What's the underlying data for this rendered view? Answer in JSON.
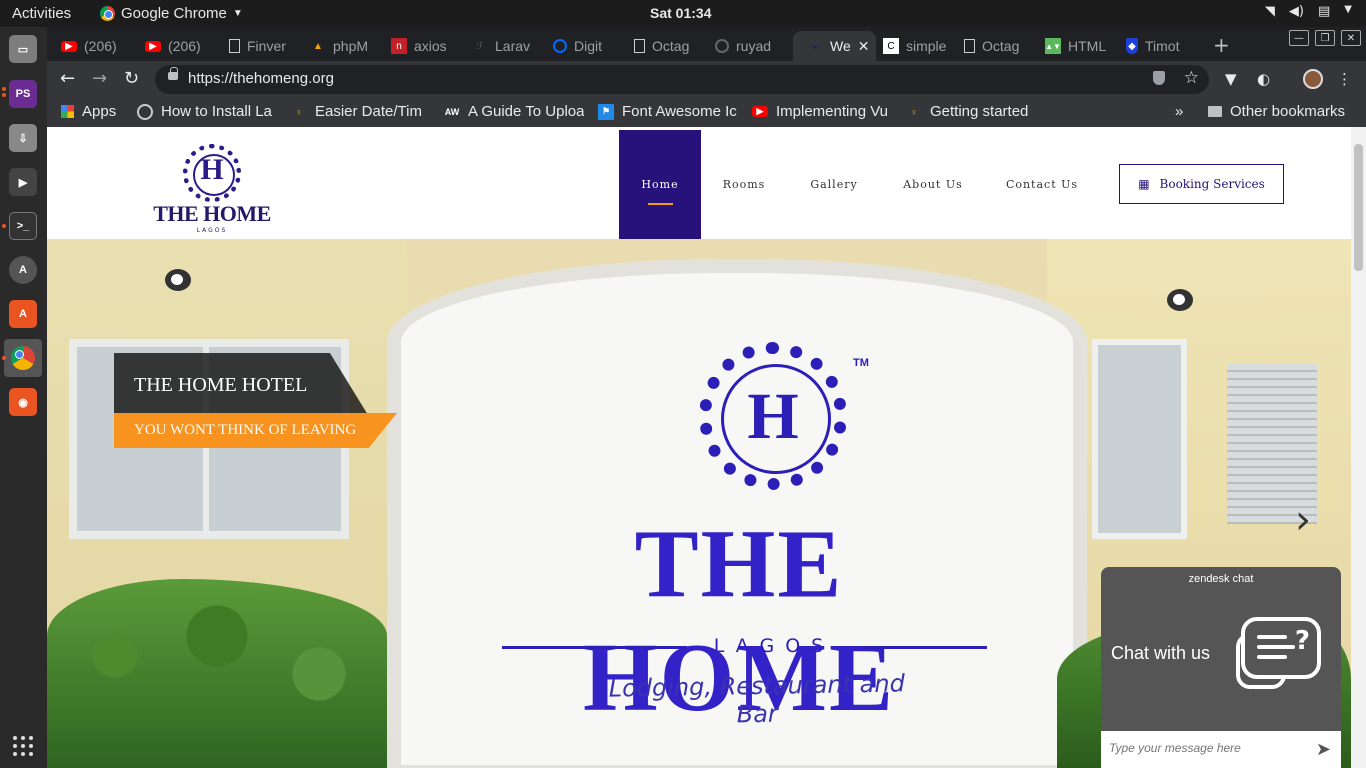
{
  "system": {
    "activities": "Activities",
    "app_name": "Google Chrome",
    "clock": "Sat 01:34",
    "tray": [
      "wifi-icon",
      "volume-icon",
      "clipboard-icon",
      "power-menu-icon"
    ]
  },
  "dock": {
    "apps": [
      "files-icon",
      "phpstorm-icon",
      "install-icon",
      "video-icon",
      "terminal-icon",
      "updater-icon",
      "software-center-icon",
      "chrome-icon",
      "screenshot-icon"
    ]
  },
  "tabs": [
    {
      "label": "(206)",
      "icon": "youtube-icon"
    },
    {
      "label": "(206)",
      "icon": "youtube-icon"
    },
    {
      "label": "Finver",
      "icon": "document-icon"
    },
    {
      "label": "phpM",
      "icon": "phpmyadmin-icon"
    },
    {
      "label": "axios",
      "icon": "npm-icon"
    },
    {
      "label": "Larav",
      "icon": "laravel-icon"
    },
    {
      "label": "Digit",
      "icon": "digitalocean-icon"
    },
    {
      "label": "Octag",
      "icon": "document-icon"
    },
    {
      "label": "ruyad",
      "icon": "github-icon"
    },
    {
      "label": "We",
      "icon": "site-icon",
      "active": true,
      "close": "✕"
    },
    {
      "label": "simple",
      "icon": "codepen-icon"
    },
    {
      "label": "Octag",
      "icon": "document-icon"
    },
    {
      "label": "HTML",
      "icon": "html-icon"
    },
    {
      "label": "Timot",
      "icon": "shield-icon"
    }
  ],
  "window_controls": {
    "minimize": "—",
    "restore": "❐",
    "close": "✕"
  },
  "toolbar": {
    "url": "https://thehomeng.org",
    "new_tab": "+"
  },
  "bookmarks": [
    {
      "label": "Apps",
      "icon": "apps-icon"
    },
    {
      "label": "How to Install La",
      "icon": "site-icon"
    },
    {
      "label": "Easier Date/Tim",
      "icon": "bulb-icon"
    },
    {
      "label": "A Guide To Uploa",
      "icon": "aw-icon"
    },
    {
      "label": "Font Awesome Ic",
      "icon": "flag-icon"
    },
    {
      "label": "Implementing Vu",
      "icon": "youtube-icon"
    },
    {
      "label": "Getting started",
      "icon": "bulb-icon"
    },
    {
      "label": "»",
      "icon": ""
    },
    {
      "label": "Other bookmarks",
      "icon": "folder-icon"
    }
  ],
  "site": {
    "logo": {
      "letter": "H",
      "name": "THE HOME",
      "sub": "LAGOS"
    },
    "menu": [
      "Home",
      "Rooms",
      "Gallery",
      "About Us",
      "Contact Us"
    ],
    "booking": "Booking Services",
    "hero": {
      "title": "THE HOME HOTEL",
      "subtitle": "YOU WONT THINK OF LEAVING",
      "sign_letter": "H",
      "sign_tm": "TM",
      "sign_name": "THE HOME",
      "sign_lagos": "LAGOS",
      "sign_tagline": "Lodging, Restaurant and Bar",
      "next": "›"
    }
  },
  "chat": {
    "brand": "zendesk chat",
    "title": "Chat with us",
    "placeholder": "Type your message here"
  },
  "colors": {
    "brand_purple": "#27117a",
    "accent_orange": "#f7931e"
  }
}
